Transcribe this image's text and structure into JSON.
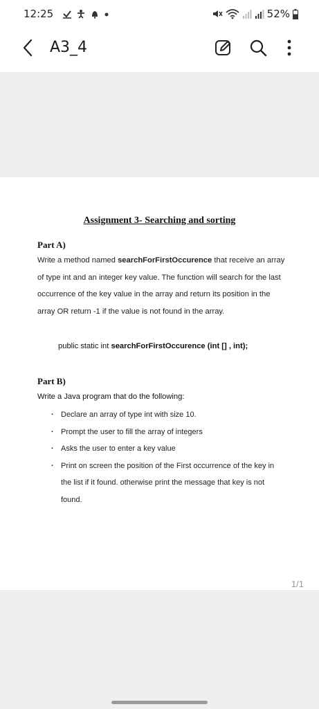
{
  "status_bar": {
    "time": "12:25",
    "battery": "52%",
    "left_icons": [
      "download-icon",
      "accessibility-icon",
      "notification-icon",
      "dot-icon"
    ],
    "right_icons": [
      "mute-icon",
      "wifi-icon",
      "signal-icon",
      "signal-icon",
      "battery-icon"
    ]
  },
  "app_bar": {
    "title": "A3_4",
    "icons": [
      "back-icon",
      "edit-icon",
      "search-icon",
      "more-icon"
    ]
  },
  "document": {
    "heading": "Assignment 3- Searching and sorting",
    "part_a": {
      "title": "Part A)",
      "text_before": "Write a method named ",
      "method_name": "searchForFirstOccurence",
      "text_after": " that receive an array of type int and an integer key value. The function will search for the last occurrence of the key value in the array and return its position in the array OR return -1 if the value is not found in the array.",
      "code_prefix": "public static int ",
      "code_name": "searchForFirstOccurence",
      "code_suffix": " (int [] , int);"
    },
    "part_b": {
      "title": "Part B)",
      "intro": "Write a Java program that do the following:",
      "items": [
        "Declare an array of type int with size 10.",
        "Prompt the user to fill the array of integers",
        "Asks the user to enter a key value",
        "Print on screen the position of the First occurrence of the key in the list if it found. otherwise print the message that key is not found."
      ]
    },
    "page_counter": "1/1"
  },
  "colors": {
    "viewer_background": "#efefef",
    "page": "#ffffff",
    "text": "#222222",
    "muted": "#9a9a9a"
  }
}
